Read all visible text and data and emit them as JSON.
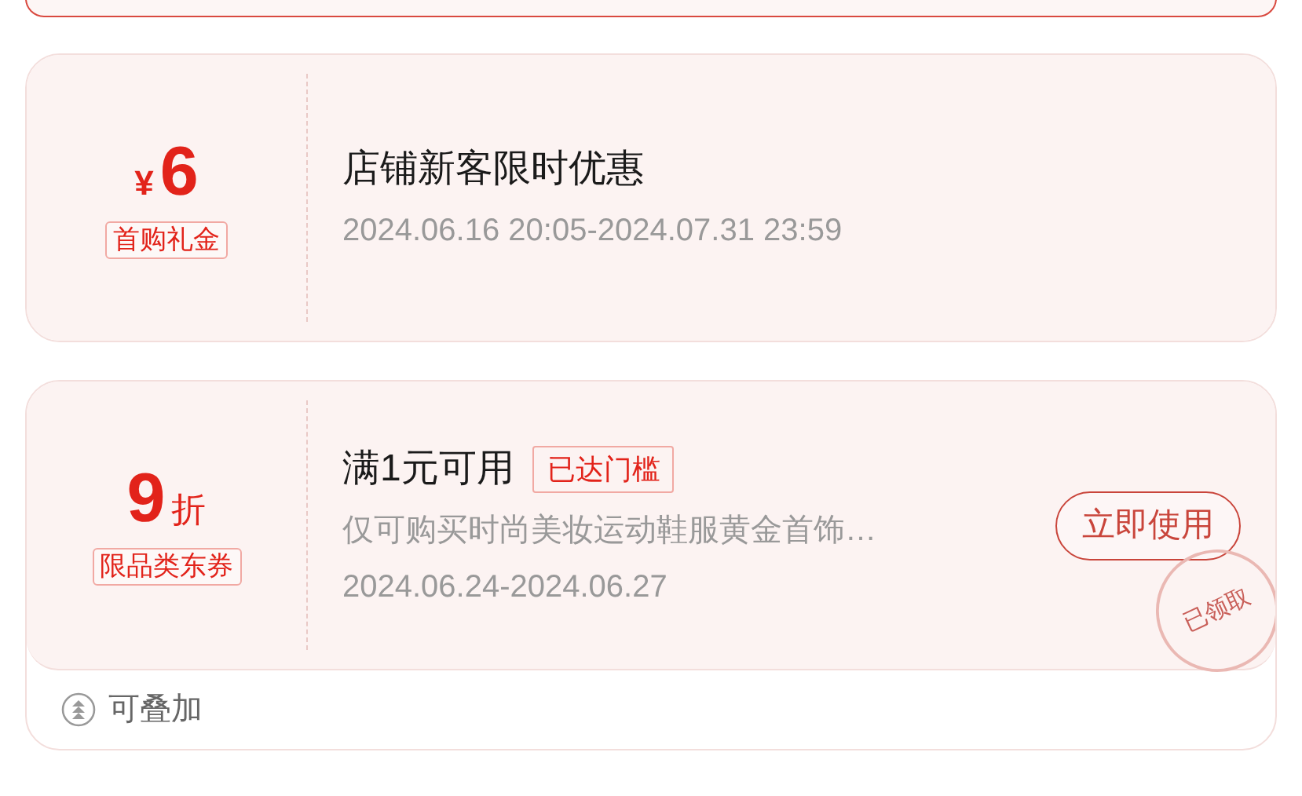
{
  "coupons": [
    {
      "kind": "amount",
      "currency": "¥",
      "value": "6",
      "tag": "首购礼金",
      "title": "店铺新客限时优惠",
      "validity": "2024.06.16 20:05-2024.07.31 23:59"
    },
    {
      "kind": "discount",
      "value": "9",
      "unit": "折",
      "tag": "限品类东券",
      "title": "满1元可用",
      "badge": "已达门槛",
      "scope": "仅可购买时尚美妆运动鞋服黄金首饰…",
      "validity": "2024.06.24-2024.06.27",
      "button": "立即使用",
      "stamp": "已领取",
      "footer": "可叠加"
    }
  ]
}
